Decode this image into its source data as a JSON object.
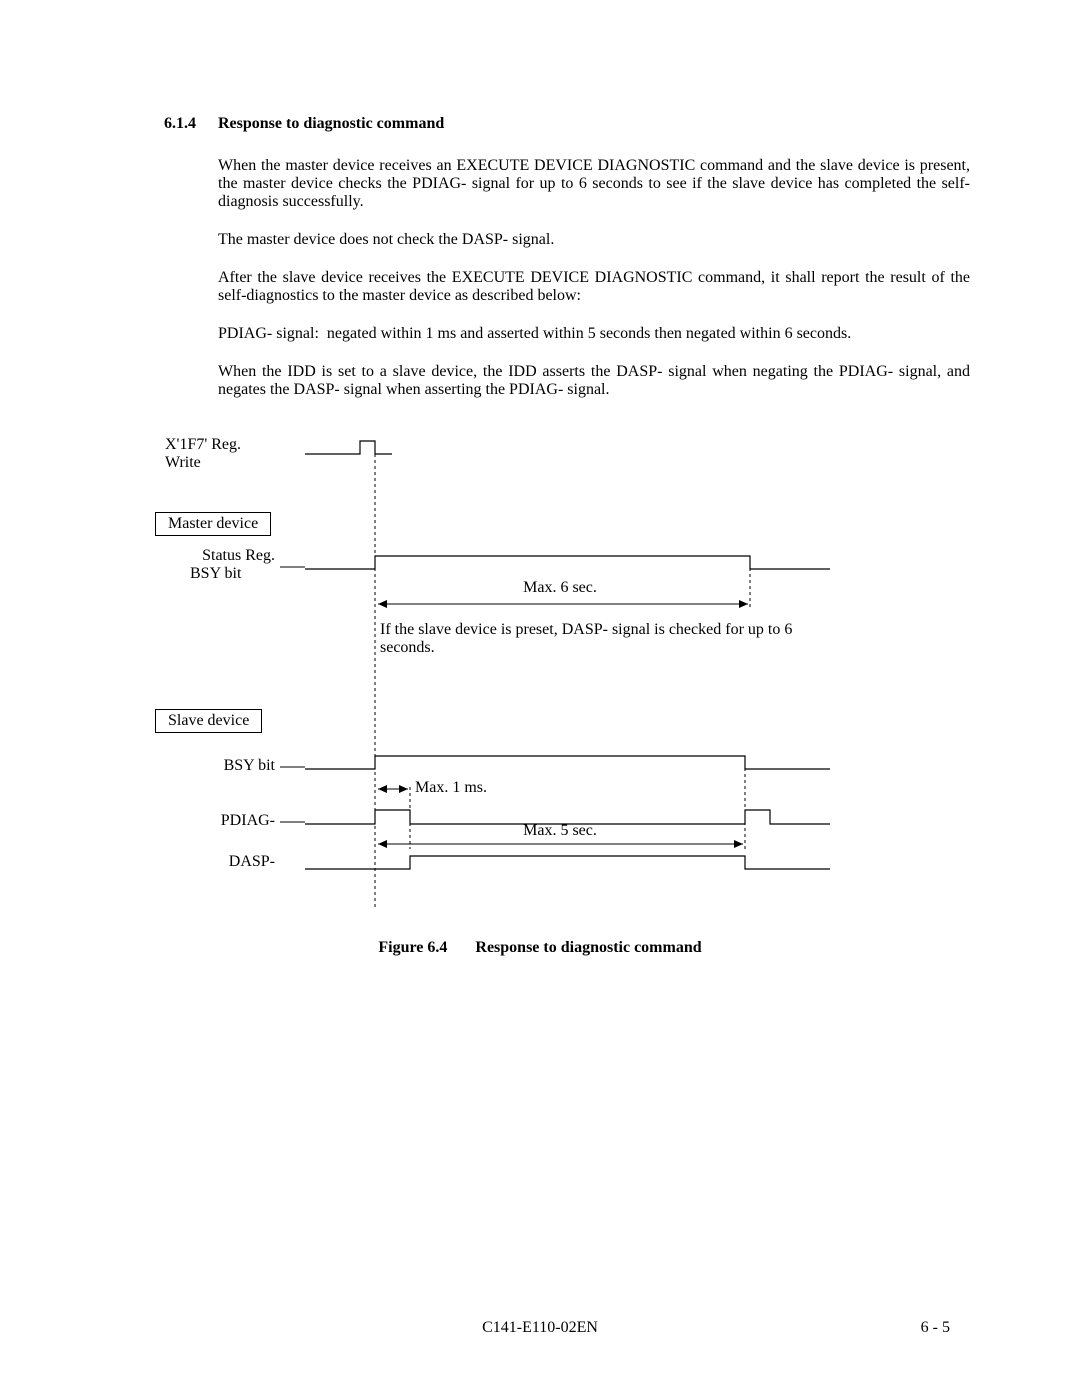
{
  "section": {
    "number": "6.1.4",
    "title": "Response to diagnostic command"
  },
  "paragraphs": {
    "p1": "When the master device receives an EXECUTE DEVICE DIAGNOSTIC command and the slave device is present, the master device checks the PDIAG- signal for up to 6 seconds to see if the slave device has completed the self-diagnosis successfully.",
    "p2": "The master device does not check the DASP- signal.",
    "p3": "After the slave device receives the EXECUTE DEVICE DIAGNOSTIC command, it shall report the result of the self-diagnostics to the master device as described below:",
    "signal_label": "PDIAG- signal:",
    "signal_desc": "negated within 1 ms and asserted within 5 seconds then negated within 6 seconds.",
    "p4": "When the IDD is set to a slave device, the IDD asserts the DASP- signal when negating the PDIAG- signal, and negates the DASP- signal when asserting the PDIAG- signal."
  },
  "diagram": {
    "reg_write_1": "X'1F7' Reg.",
    "reg_write_2": "Write",
    "master_device": "Master device",
    "status_reg": "Status Reg.",
    "master_bsy": "BSY bit",
    "max6": "Max. 6 sec.",
    "check_note": "If the slave device is preset, DASP- signal is checked for up to 6 seconds.",
    "slave_device": "Slave device",
    "slave_bsy": "BSY bit",
    "pdiag": "PDIAG-",
    "dasp": "DASP-",
    "max1ms": "Max. 1 ms.",
    "max5": "Max. 5 sec."
  },
  "figure": {
    "num": "Figure 6.4",
    "title": "Response to diagnostic command"
  },
  "footer": {
    "doc": "C141-E110-02EN",
    "page": "6 - 5"
  }
}
